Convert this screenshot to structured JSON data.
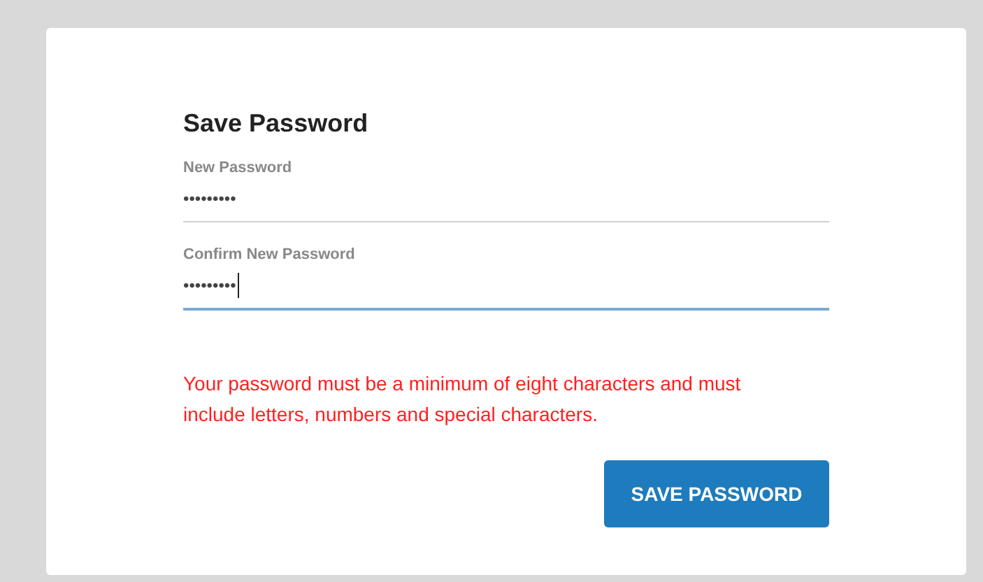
{
  "form": {
    "title": "Save Password",
    "fields": [
      {
        "label": "New Password",
        "value": "•••••••••",
        "focused": false
      },
      {
        "label": "Confirm New Password",
        "value": "•••••••••",
        "focused": true
      }
    ],
    "error": "Your password must be a minimum of eight characters and must include letters, numbers and special characters.",
    "button": "SAVE PASSWORD"
  }
}
